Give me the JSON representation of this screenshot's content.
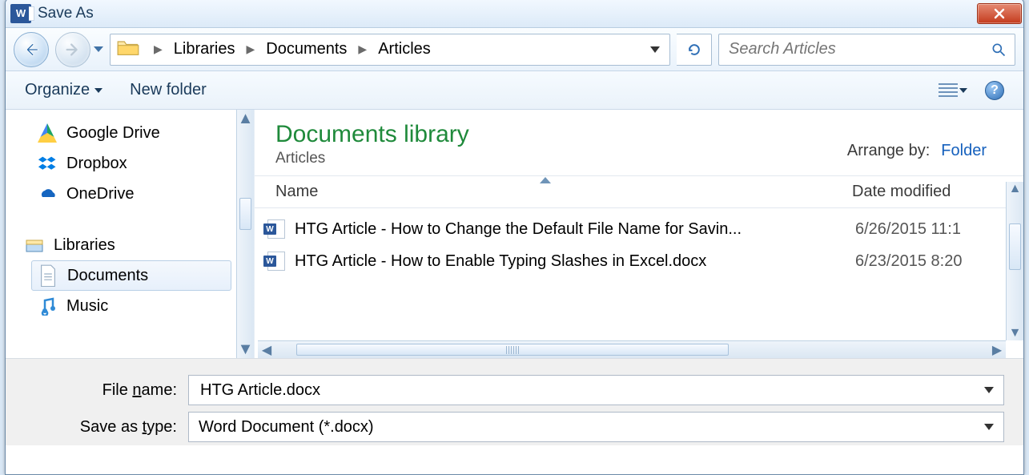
{
  "window": {
    "title": "Save As"
  },
  "breadcrumb": {
    "p1": "Libraries",
    "p2": "Documents",
    "p3": "Articles"
  },
  "search": {
    "placeholder": "Search Articles"
  },
  "toolbar": {
    "organize": "Organize",
    "newfolder": "New folder"
  },
  "nav": {
    "gdrive": "Google Drive",
    "dropbox": "Dropbox",
    "onedrive": "OneDrive",
    "libraries": "Libraries",
    "documents": "Documents",
    "music": "Music"
  },
  "library": {
    "title": "Documents library",
    "subtitle": "Articles",
    "arrange_label": "Arrange by:",
    "arrange_value": "Folder"
  },
  "columns": {
    "name": "Name",
    "date": "Date modified"
  },
  "files": [
    {
      "name": "HTG Article - How to Change the Default File Name for Savin...",
      "date": "6/26/2015 11:1"
    },
    {
      "name": "HTG Article - How to Enable Typing Slashes in Excel.docx",
      "date": "6/23/2015 8:20"
    }
  ],
  "form": {
    "filename_label_pre": "File ",
    "filename_label_u": "n",
    "filename_label_post": "ame:",
    "filename_value": "HTG Article.docx",
    "savetype_label_pre": "Save as ",
    "savetype_label_u": "t",
    "savetype_label_post": "ype:",
    "savetype_value": "Word Document (*.docx)"
  }
}
